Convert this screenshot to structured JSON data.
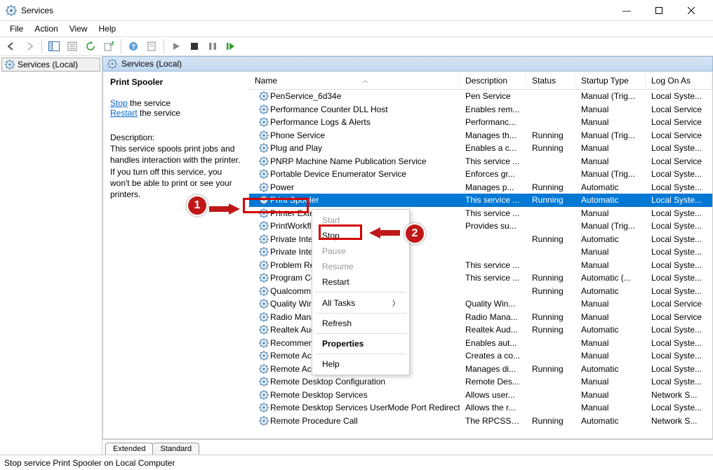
{
  "window": {
    "title": "Services"
  },
  "menu": {
    "file": "File",
    "action": "Action",
    "view": "View",
    "help": "Help"
  },
  "winbtn": {
    "min": "—",
    "max": "▢",
    "close": "✕"
  },
  "tree": {
    "root": "Services (Local)"
  },
  "header": {
    "label": "Services (Local)"
  },
  "details": {
    "title": "Print Spooler",
    "stop_link": "Stop",
    "stop_text": " the service",
    "restart_link": "Restart",
    "restart_text": " the service",
    "desc_label": "Description:",
    "desc_text": "This service spools print jobs and handles interaction with the printer. If you turn off this service, you won't be able to print or see your printers."
  },
  "columns": {
    "name": "Name",
    "desc": "Description",
    "status": "Status",
    "startup": "Startup Type",
    "logon": "Log On As"
  },
  "rows": [
    {
      "name": "PenService_6d34e",
      "desc": "Pen Service",
      "status": "",
      "startup": "Manual (Trig...",
      "logon": "Local Syste..."
    },
    {
      "name": "Performance Counter DLL Host",
      "desc": "Enables rem...",
      "status": "",
      "startup": "Manual",
      "logon": "Local Service"
    },
    {
      "name": "Performance Logs & Alerts",
      "desc": "Performanc...",
      "status": "",
      "startup": "Manual",
      "logon": "Local Service"
    },
    {
      "name": "Phone Service",
      "desc": "Manages th...",
      "status": "Running",
      "startup": "Manual (Trig...",
      "logon": "Local Service"
    },
    {
      "name": "Plug and Play",
      "desc": "Enables a c...",
      "status": "Running",
      "startup": "Manual",
      "logon": "Local Syste..."
    },
    {
      "name": "PNRP Machine Name Publication Service",
      "desc": "This service ...",
      "status": "",
      "startup": "Manual",
      "logon": "Local Service"
    },
    {
      "name": "Portable Device Enumerator Service",
      "desc": "Enforces gr...",
      "status": "",
      "startup": "Manual (Trig...",
      "logon": "Local Syste..."
    },
    {
      "name": "Power",
      "desc": "Manages p...",
      "status": "Running",
      "startup": "Automatic",
      "logon": "Local Syste..."
    },
    {
      "name": "Print Spooler",
      "desc": "This service ...",
      "status": "Running",
      "startup": "Automatic",
      "logon": "Local Syste...",
      "selected": true
    },
    {
      "name": "Printer Exten",
      "desc": "This service ...",
      "status": "",
      "startup": "Manual",
      "logon": "Local Syste..."
    },
    {
      "name": "PrintWorkflo",
      "desc": "Provides su...",
      "status": "",
      "startup": "Manual (Trig...",
      "logon": "Local Syste..."
    },
    {
      "name": "Private Intern",
      "desc": "",
      "status": "Running",
      "startup": "Automatic",
      "logon": "Local Syste..."
    },
    {
      "name": "Private Intern",
      "desc": "",
      "status": "",
      "startup": "Manual",
      "logon": "Local Syste..."
    },
    {
      "name": "Problem Rep",
      "desc": "This service ...",
      "status": "",
      "startup": "Manual",
      "logon": "Local Syste..."
    },
    {
      "name": "Program Con",
      "desc": "This service ...",
      "status": "Running",
      "startup": "Automatic (...",
      "logon": "Local Syste..."
    },
    {
      "name": "Qualcomm A",
      "desc": "",
      "status": "Running",
      "startup": "Automatic",
      "logon": "Local Syste..."
    },
    {
      "name": "Quality Winc",
      "desc": "Quality Win...",
      "status": "",
      "startup": "Manual",
      "logon": "Local Service"
    },
    {
      "name": "Radio Manag",
      "desc": "Radio Mana...",
      "status": "Running",
      "startup": "Manual",
      "logon": "Local Service"
    },
    {
      "name": "Realtek Audi",
      "desc": "Realtek Aud...",
      "status": "Running",
      "startup": "Automatic",
      "logon": "Local Syste..."
    },
    {
      "name": "Recommend",
      "desc": "Enables aut...",
      "status": "",
      "startup": "Manual",
      "logon": "Local Syste..."
    },
    {
      "name": "Remote Acc",
      "desc": "Creates a co...",
      "status": "",
      "startup": "Manual",
      "logon": "Local Syste..."
    },
    {
      "name": "Remote Access Connection Manager",
      "desc": "Manages di...",
      "status": "Running",
      "startup": "Automatic",
      "logon": "Local Syste..."
    },
    {
      "name": "Remote Desktop Configuration",
      "desc": "Remote Des...",
      "status": "",
      "startup": "Manual",
      "logon": "Local Syste..."
    },
    {
      "name": "Remote Desktop Services",
      "desc": "Allows user...",
      "status": "",
      "startup": "Manual",
      "logon": "Network S..."
    },
    {
      "name": "Remote Desktop Services UserMode Port Redirector",
      "desc": "Allows the r...",
      "status": "",
      "startup": "Manual",
      "logon": "Local Syste..."
    },
    {
      "name": "Remote Procedure Call",
      "desc": "The RPCSS s...",
      "status": "Running",
      "startup": "Automatic",
      "logon": "Network S..."
    }
  ],
  "tabs": {
    "extended": "Extended",
    "standard": "Standard"
  },
  "ctx": {
    "start": "Start",
    "stop": "Stop",
    "pause": "Pause",
    "resume": "Resume",
    "restart": "Restart",
    "alltasks": "All Tasks",
    "refresh": "Refresh",
    "properties": "Properties",
    "help": "Help"
  },
  "status": {
    "text": "Stop service Print Spooler on Local Computer"
  },
  "anno": {
    "one": "1",
    "two": "2"
  }
}
